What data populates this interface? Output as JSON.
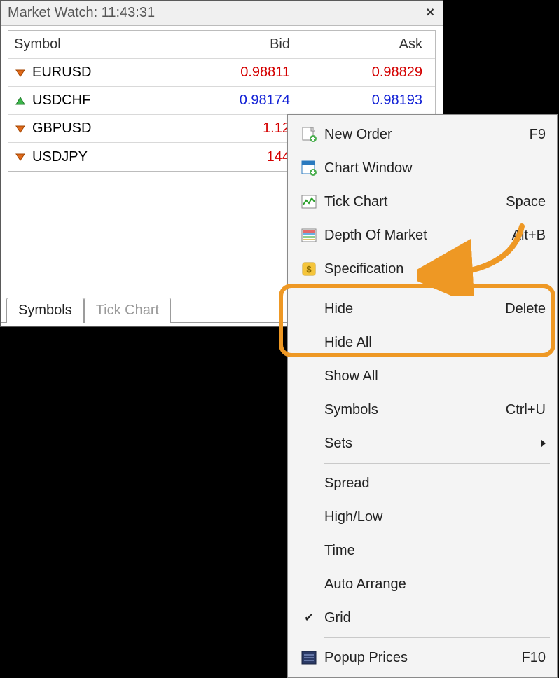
{
  "panel": {
    "title": "Market Watch: 11:43:31",
    "columns": {
      "symbol": "Symbol",
      "bid": "Bid",
      "ask": "Ask"
    },
    "tabs": {
      "symbols": "Symbols",
      "tick_chart": "Tick Chart"
    }
  },
  "rows": [
    {
      "symbol": "EURUSD",
      "dir": "down",
      "bid": "0.98811",
      "ask": "0.98829"
    },
    {
      "symbol": "USDCHF",
      "dir": "up",
      "bid": "0.98174",
      "ask": "0.98193"
    },
    {
      "symbol": "GBPUSD",
      "dir": "down",
      "bid": "1.12",
      "ask": ""
    },
    {
      "symbol": "USDJPY",
      "dir": "down",
      "bid": "144",
      "ask": ""
    }
  ],
  "menu": {
    "new_order": {
      "label": "New Order",
      "shortcut": "F9"
    },
    "chart_window": {
      "label": "Chart Window",
      "shortcut": ""
    },
    "tick_chart": {
      "label": "Tick Chart",
      "shortcut": "Space"
    },
    "depth": {
      "label": "Depth Of Market",
      "shortcut": "Alt+B"
    },
    "spec": {
      "label": "Specification",
      "shortcut": ""
    },
    "hide": {
      "label": "Hide",
      "shortcut": "Delete"
    },
    "hide_all": {
      "label": "Hide All",
      "shortcut": ""
    },
    "show_all": {
      "label": "Show All",
      "shortcut": ""
    },
    "symbols": {
      "label": "Symbols",
      "shortcut": "Ctrl+U"
    },
    "sets": {
      "label": "Sets",
      "shortcut": ""
    },
    "spread": {
      "label": "Spread",
      "shortcut": ""
    },
    "high_low": {
      "label": "High/Low",
      "shortcut": ""
    },
    "time": {
      "label": "Time",
      "shortcut": ""
    },
    "auto_arrange": {
      "label": "Auto Arrange",
      "shortcut": ""
    },
    "grid": {
      "label": "Grid",
      "shortcut": ""
    },
    "popup": {
      "label": "Popup Prices",
      "shortcut": "F10"
    }
  },
  "colors": {
    "down": "#d40000",
    "up": "#1322d6",
    "highlight": "#ee9824"
  }
}
